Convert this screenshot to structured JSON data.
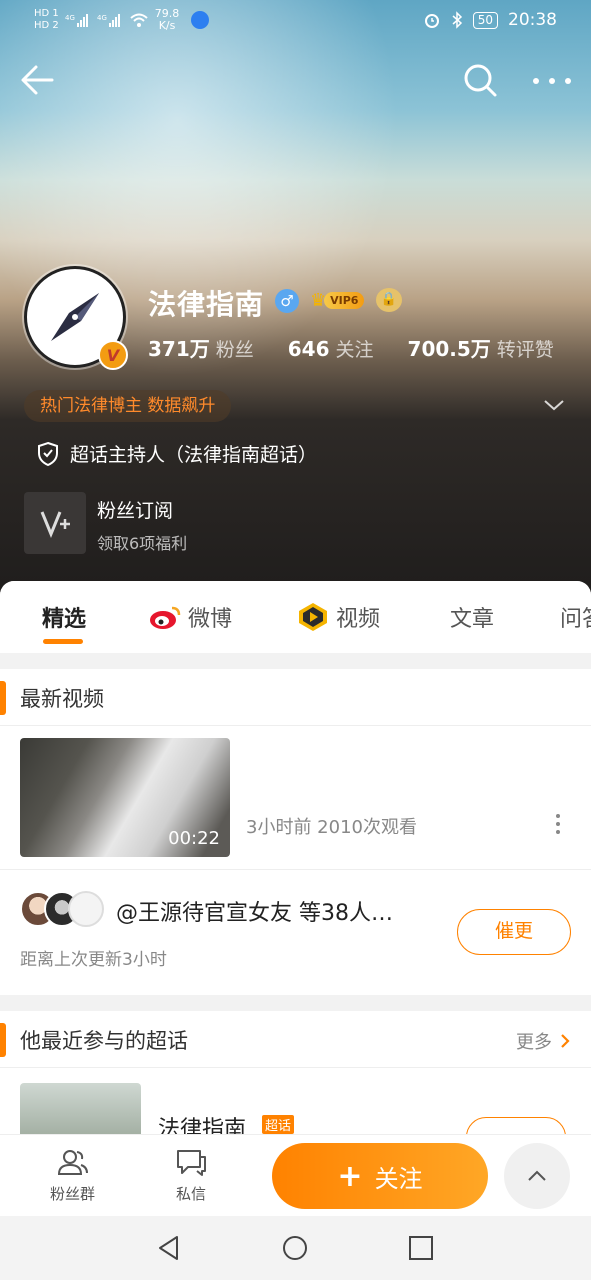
{
  "status_bar": {
    "sim1": "HD 1",
    "sim2": "HD 2",
    "net_speed": "79.8",
    "net_unit": "K/s",
    "battery": "50",
    "time": "20:38"
  },
  "nav": {
    "back_icon": "back-arrow-icon",
    "search_icon": "search-icon",
    "more_icon": "more-icon"
  },
  "profile": {
    "name": "法律指南",
    "vip_label": "VIP6",
    "followers_count": "371万",
    "followers_label": "粉丝",
    "following_count": "646",
    "following_label": "关注",
    "likes_count": "700.5万",
    "likes_label": "转评赞",
    "hot_tag": "热门法律博主 数据飙升",
    "host_text": "超话主持人（法律指南超话）",
    "subscribe_title": "粉丝订阅",
    "subscribe_desc": "领取6项福利"
  },
  "tabs": [
    {
      "label": "精选"
    },
    {
      "label": "微博"
    },
    {
      "label": "视频"
    },
    {
      "label": "文章"
    },
    {
      "label": "问答"
    }
  ],
  "latest_video": {
    "section_title": "最新视频",
    "duration": "00:22",
    "meta": "3小时前  2010次观看"
  },
  "fans_update": {
    "text": "@王源待官宣女友 等38人…",
    "update_text": "距离上次更新3小时",
    "urge_button": "催更"
  },
  "super_topics": {
    "section_title": "他最近参与的超话",
    "more_label": "更多",
    "topic_name": "法律指南",
    "topic_tag": "超话"
  },
  "action_bar": {
    "fans_group": "粉丝群",
    "message": "私信",
    "follow": "关注"
  },
  "colors": {
    "accent": "#ff8200",
    "hot_tag_text": "#ff8a2b",
    "vip_gold": "#f5b400",
    "gender_blue": "#5aa7f0"
  }
}
